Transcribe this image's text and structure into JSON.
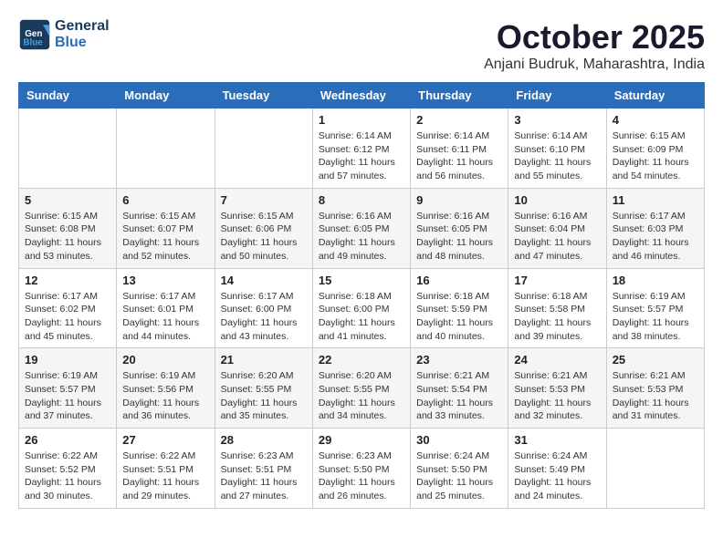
{
  "header": {
    "logo_line1": "General",
    "logo_line2": "Blue",
    "month": "October 2025",
    "location": "Anjani Budruk, Maharashtra, India"
  },
  "weekdays": [
    "Sunday",
    "Monday",
    "Tuesday",
    "Wednesday",
    "Thursday",
    "Friday",
    "Saturday"
  ],
  "weeks": [
    [
      {
        "day": "",
        "info": ""
      },
      {
        "day": "",
        "info": ""
      },
      {
        "day": "",
        "info": ""
      },
      {
        "day": "1",
        "info": "Sunrise: 6:14 AM\nSunset: 6:12 PM\nDaylight: 11 hours and 57 minutes."
      },
      {
        "day": "2",
        "info": "Sunrise: 6:14 AM\nSunset: 6:11 PM\nDaylight: 11 hours and 56 minutes."
      },
      {
        "day": "3",
        "info": "Sunrise: 6:14 AM\nSunset: 6:10 PM\nDaylight: 11 hours and 55 minutes."
      },
      {
        "day": "4",
        "info": "Sunrise: 6:15 AM\nSunset: 6:09 PM\nDaylight: 11 hours and 54 minutes."
      }
    ],
    [
      {
        "day": "5",
        "info": "Sunrise: 6:15 AM\nSunset: 6:08 PM\nDaylight: 11 hours and 53 minutes."
      },
      {
        "day": "6",
        "info": "Sunrise: 6:15 AM\nSunset: 6:07 PM\nDaylight: 11 hours and 52 minutes."
      },
      {
        "day": "7",
        "info": "Sunrise: 6:15 AM\nSunset: 6:06 PM\nDaylight: 11 hours and 50 minutes."
      },
      {
        "day": "8",
        "info": "Sunrise: 6:16 AM\nSunset: 6:05 PM\nDaylight: 11 hours and 49 minutes."
      },
      {
        "day": "9",
        "info": "Sunrise: 6:16 AM\nSunset: 6:05 PM\nDaylight: 11 hours and 48 minutes."
      },
      {
        "day": "10",
        "info": "Sunrise: 6:16 AM\nSunset: 6:04 PM\nDaylight: 11 hours and 47 minutes."
      },
      {
        "day": "11",
        "info": "Sunrise: 6:17 AM\nSunset: 6:03 PM\nDaylight: 11 hours and 46 minutes."
      }
    ],
    [
      {
        "day": "12",
        "info": "Sunrise: 6:17 AM\nSunset: 6:02 PM\nDaylight: 11 hours and 45 minutes."
      },
      {
        "day": "13",
        "info": "Sunrise: 6:17 AM\nSunset: 6:01 PM\nDaylight: 11 hours and 44 minutes."
      },
      {
        "day": "14",
        "info": "Sunrise: 6:17 AM\nSunset: 6:00 PM\nDaylight: 11 hours and 43 minutes."
      },
      {
        "day": "15",
        "info": "Sunrise: 6:18 AM\nSunset: 6:00 PM\nDaylight: 11 hours and 41 minutes."
      },
      {
        "day": "16",
        "info": "Sunrise: 6:18 AM\nSunset: 5:59 PM\nDaylight: 11 hours and 40 minutes."
      },
      {
        "day": "17",
        "info": "Sunrise: 6:18 AM\nSunset: 5:58 PM\nDaylight: 11 hours and 39 minutes."
      },
      {
        "day": "18",
        "info": "Sunrise: 6:19 AM\nSunset: 5:57 PM\nDaylight: 11 hours and 38 minutes."
      }
    ],
    [
      {
        "day": "19",
        "info": "Sunrise: 6:19 AM\nSunset: 5:57 PM\nDaylight: 11 hours and 37 minutes."
      },
      {
        "day": "20",
        "info": "Sunrise: 6:19 AM\nSunset: 5:56 PM\nDaylight: 11 hours and 36 minutes."
      },
      {
        "day": "21",
        "info": "Sunrise: 6:20 AM\nSunset: 5:55 PM\nDaylight: 11 hours and 35 minutes."
      },
      {
        "day": "22",
        "info": "Sunrise: 6:20 AM\nSunset: 5:55 PM\nDaylight: 11 hours and 34 minutes."
      },
      {
        "day": "23",
        "info": "Sunrise: 6:21 AM\nSunset: 5:54 PM\nDaylight: 11 hours and 33 minutes."
      },
      {
        "day": "24",
        "info": "Sunrise: 6:21 AM\nSunset: 5:53 PM\nDaylight: 11 hours and 32 minutes."
      },
      {
        "day": "25",
        "info": "Sunrise: 6:21 AM\nSunset: 5:53 PM\nDaylight: 11 hours and 31 minutes."
      }
    ],
    [
      {
        "day": "26",
        "info": "Sunrise: 6:22 AM\nSunset: 5:52 PM\nDaylight: 11 hours and 30 minutes."
      },
      {
        "day": "27",
        "info": "Sunrise: 6:22 AM\nSunset: 5:51 PM\nDaylight: 11 hours and 29 minutes."
      },
      {
        "day": "28",
        "info": "Sunrise: 6:23 AM\nSunset: 5:51 PM\nDaylight: 11 hours and 27 minutes."
      },
      {
        "day": "29",
        "info": "Sunrise: 6:23 AM\nSunset: 5:50 PM\nDaylight: 11 hours and 26 minutes."
      },
      {
        "day": "30",
        "info": "Sunrise: 6:24 AM\nSunset: 5:50 PM\nDaylight: 11 hours and 25 minutes."
      },
      {
        "day": "31",
        "info": "Sunrise: 6:24 AM\nSunset: 5:49 PM\nDaylight: 11 hours and 24 minutes."
      },
      {
        "day": "",
        "info": ""
      }
    ]
  ]
}
